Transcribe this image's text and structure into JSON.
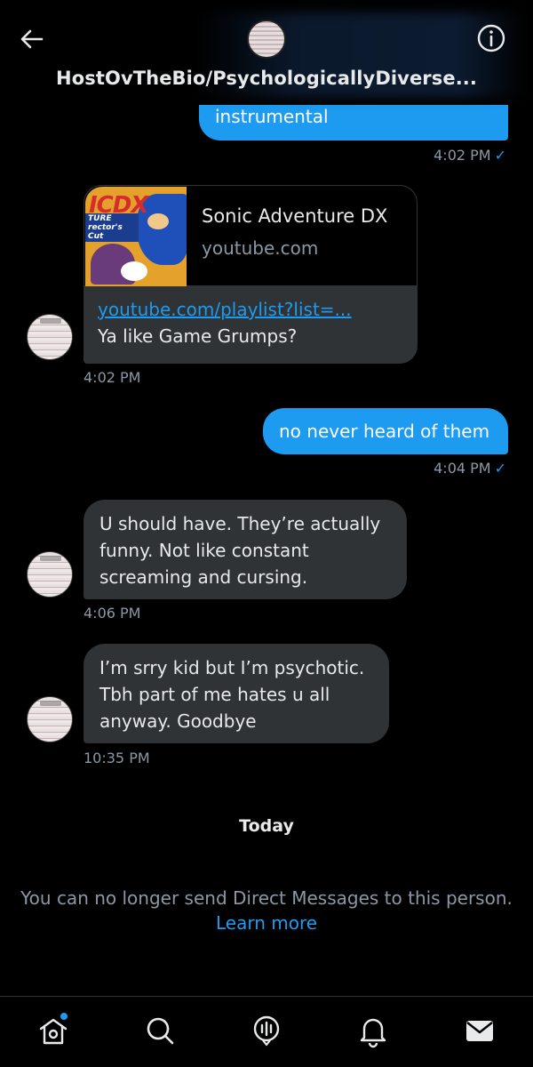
{
  "header": {
    "title": "HostOvTheBio/PsychologicallyDiverse..."
  },
  "messages": {
    "m1": {
      "text": "instrumental",
      "time": "4:02 PM",
      "check": "✓"
    },
    "card": {
      "title": "Sonic Adventure DX",
      "domain": "youtube.com",
      "thumb_title_a": "IC",
      "thumb_title_b": "DX",
      "thumb_sub": "TURE rector's Cut",
      "link": "youtube.com/playlist?list=...",
      "text": "Ya like Game Grumps?",
      "time": "4:02 PM"
    },
    "m3": {
      "text": "no never heard of them",
      "time": "4:04 PM",
      "check": "✓"
    },
    "m4": {
      "lines": [
        "U should have. They’re actually",
        "funny. Not like constant",
        "screaming and cursing."
      ],
      "time": "4:06 PM"
    },
    "m5": {
      "lines": [
        "I’m srry kid but I’m psychotic.",
        "Tbh part of me hates u all",
        "anyway. Goodbye"
      ],
      "time": "10:35 PM"
    }
  },
  "divider": "Today",
  "notice": {
    "text": "You can no longer send Direct Messages to this person.",
    "link": "Learn more"
  },
  "nav": {
    "items": [
      "home-icon",
      "search-icon",
      "spaces-icon",
      "notifications-icon",
      "messages-icon"
    ],
    "accent": "#1d9bf0"
  }
}
